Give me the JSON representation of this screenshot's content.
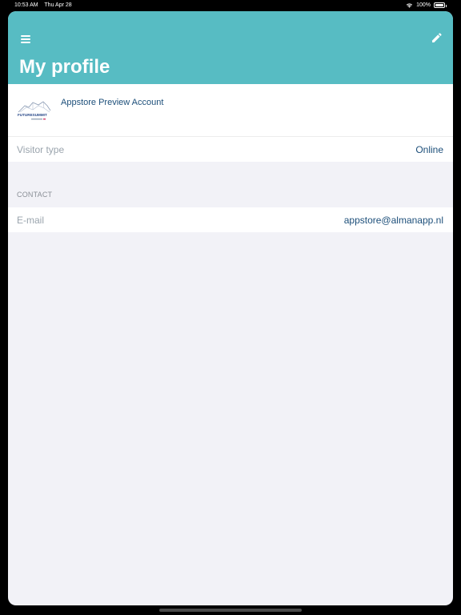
{
  "status_bar": {
    "time": "10:53 AM",
    "date": "Thu Apr 28",
    "battery": "100%"
  },
  "header": {
    "title": "My profile",
    "menu_icon": "hamburger-menu-icon",
    "edit_icon": "pencil-icon",
    "background": "#57bcc3"
  },
  "profile": {
    "logo": "future-summit-logo",
    "logo_text": "FUTURESUMMIT",
    "name": "Appstore Preview Account"
  },
  "visitor": {
    "label": "Visitor type",
    "value": "Online"
  },
  "contact": {
    "section_label": "CONTACT",
    "email_label": "E-mail",
    "email_value": "appstore@almanapp.nl"
  },
  "colors": {
    "accent": "#57bcc3",
    "value_text": "#1d4f7a",
    "label_text": "#9aa4ad",
    "background": "#f2f2f7"
  }
}
